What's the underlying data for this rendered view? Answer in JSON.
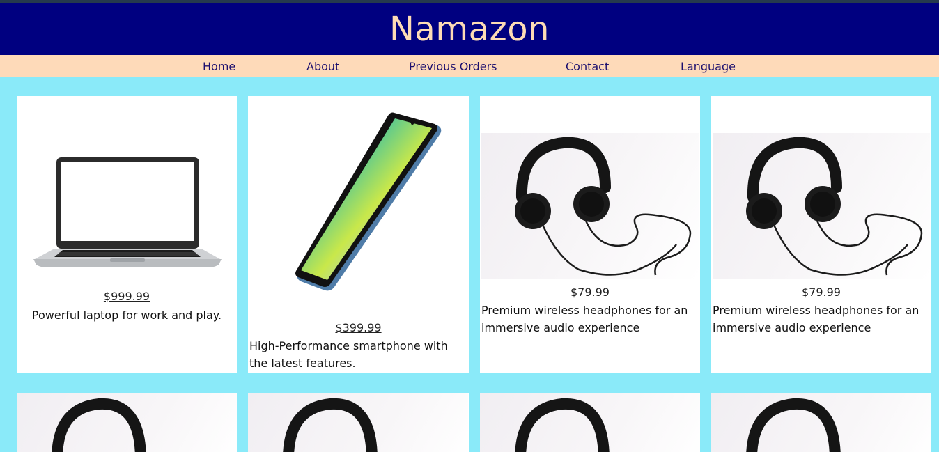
{
  "site": {
    "title": "Namazon"
  },
  "nav": {
    "items": [
      {
        "label": "Home"
      },
      {
        "label": "About"
      },
      {
        "label": "Previous Orders"
      },
      {
        "label": "Contact"
      },
      {
        "label": "Language"
      }
    ]
  },
  "products": [
    {
      "price": "$999.99",
      "description": "Powerful laptop for work and play.",
      "image": "laptop-image"
    },
    {
      "price": "$399.99",
      "description": "High-Performance smartphone with the latest features.",
      "image": "smartphone-image"
    },
    {
      "price": "$79.99",
      "description": "Premium wireless headphones for an immersive audio experience",
      "image": "headphones-image"
    },
    {
      "price": "$79.99",
      "description": "Premium wireless headphones for an immersive audio experience",
      "image": "headphones-image"
    }
  ],
  "colors": {
    "header_bg": "#000080",
    "title_color": "#fddbb5",
    "nav_bg": "#fedab9",
    "nav_text": "#1c0f6e",
    "page_bg": "#8aeaf9",
    "card_bg": "#ffffff"
  }
}
